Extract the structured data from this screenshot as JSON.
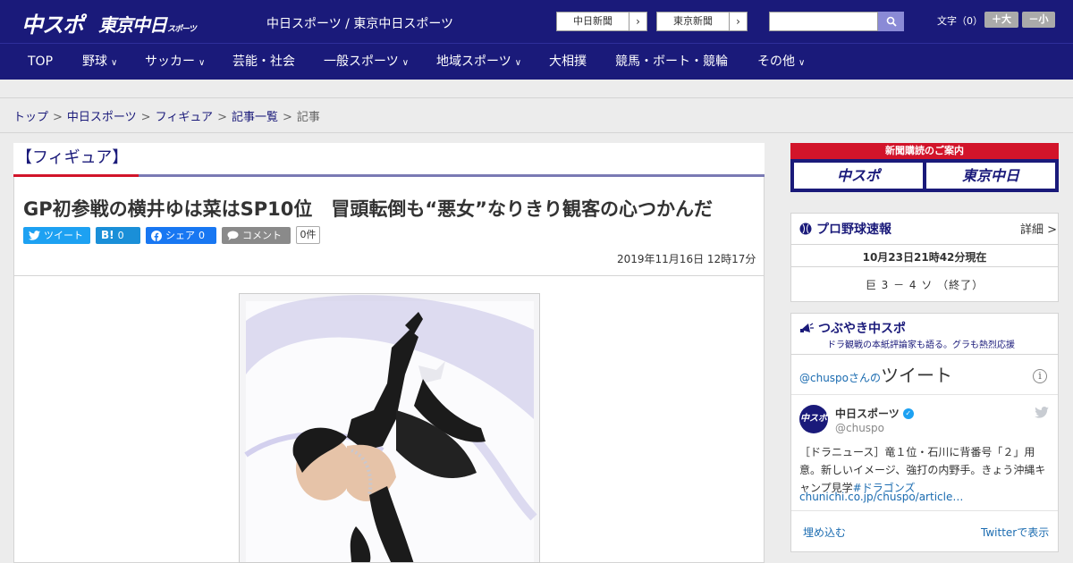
{
  "header": {
    "logo_chuspo": "中スポ",
    "logo_tokyo": "東京中日",
    "logo_tokyo_small": "スポーツ",
    "site_links": "中日スポーツ / 東京中日スポーツ",
    "paper_chunichi": "中日新聞",
    "paper_tokyo": "東京新聞",
    "search_placeholder": "",
    "textsize_label": "文字（0）",
    "textsize_plus": "＋大",
    "textsize_minus": "－小"
  },
  "nav": {
    "items": [
      {
        "label": "TOP"
      },
      {
        "label": "野球"
      },
      {
        "label": "サッカー"
      },
      {
        "label": "芸能・社会"
      },
      {
        "label": "一般スポーツ"
      },
      {
        "label": "地域スポーツ"
      },
      {
        "label": "大相撲"
      },
      {
        "label": "競馬・ボート・競輪"
      },
      {
        "label": "その他"
      }
    ]
  },
  "breadcrumb": {
    "items": [
      "トップ",
      "中日スポーツ",
      "フィギュア",
      "記事一覧"
    ],
    "current": "記事",
    "sep": ">"
  },
  "article": {
    "category": "【フィギュア】",
    "headline": "GP初参戦の横井ゆは菜はSP10位　冒頭転倒も“悪女”なりきり観客の心つかんだ",
    "share_tweet": "ツイート",
    "share_hatena_label": "B!",
    "share_hatena_count": "0",
    "share_fb_label": "シェア",
    "share_fb_count": "0",
    "share_comment": "コメント",
    "comment_count": "0件",
    "date": "2019年11月16日 12時17分"
  },
  "sidebar": {
    "ad_title": "新聞購読のご案内",
    "ad_logo1": "中スポ",
    "ad_logo2": "東京中日",
    "baseball": {
      "title": "プロ野球速報",
      "more": "詳細 >",
      "time": "10月23日21時42分現在",
      "score": "巨 3 － 4 ソ （終了）"
    },
    "tweets": {
      "title": "つぶやき中スポ",
      "subtitle": "ドラ観戦の本紙評論家も語る。グラも熱烈応援",
      "header_user": "@chuspoさんの",
      "header_word": "ツイート",
      "avatar_text": "中スポ",
      "name": "中日スポーツ",
      "handle": "@chuspo",
      "text": "［ドラニュース］竜１位・石川に背番号「２」用意。新しいイメージ、強打の内野手。きょう沖縄キャンプ見学",
      "hashtag": "#ドラゴンズ",
      "link": "chunichi.co.jp/chuspo/article…",
      "embed": "埋め込む",
      "view": "Twitterで表示"
    }
  },
  "colors": {
    "brand_navy": "#1a1a7a",
    "accent_red": "#d2142a",
    "twitter_blue": "#1da1f2",
    "facebook_blue": "#1877f2"
  }
}
